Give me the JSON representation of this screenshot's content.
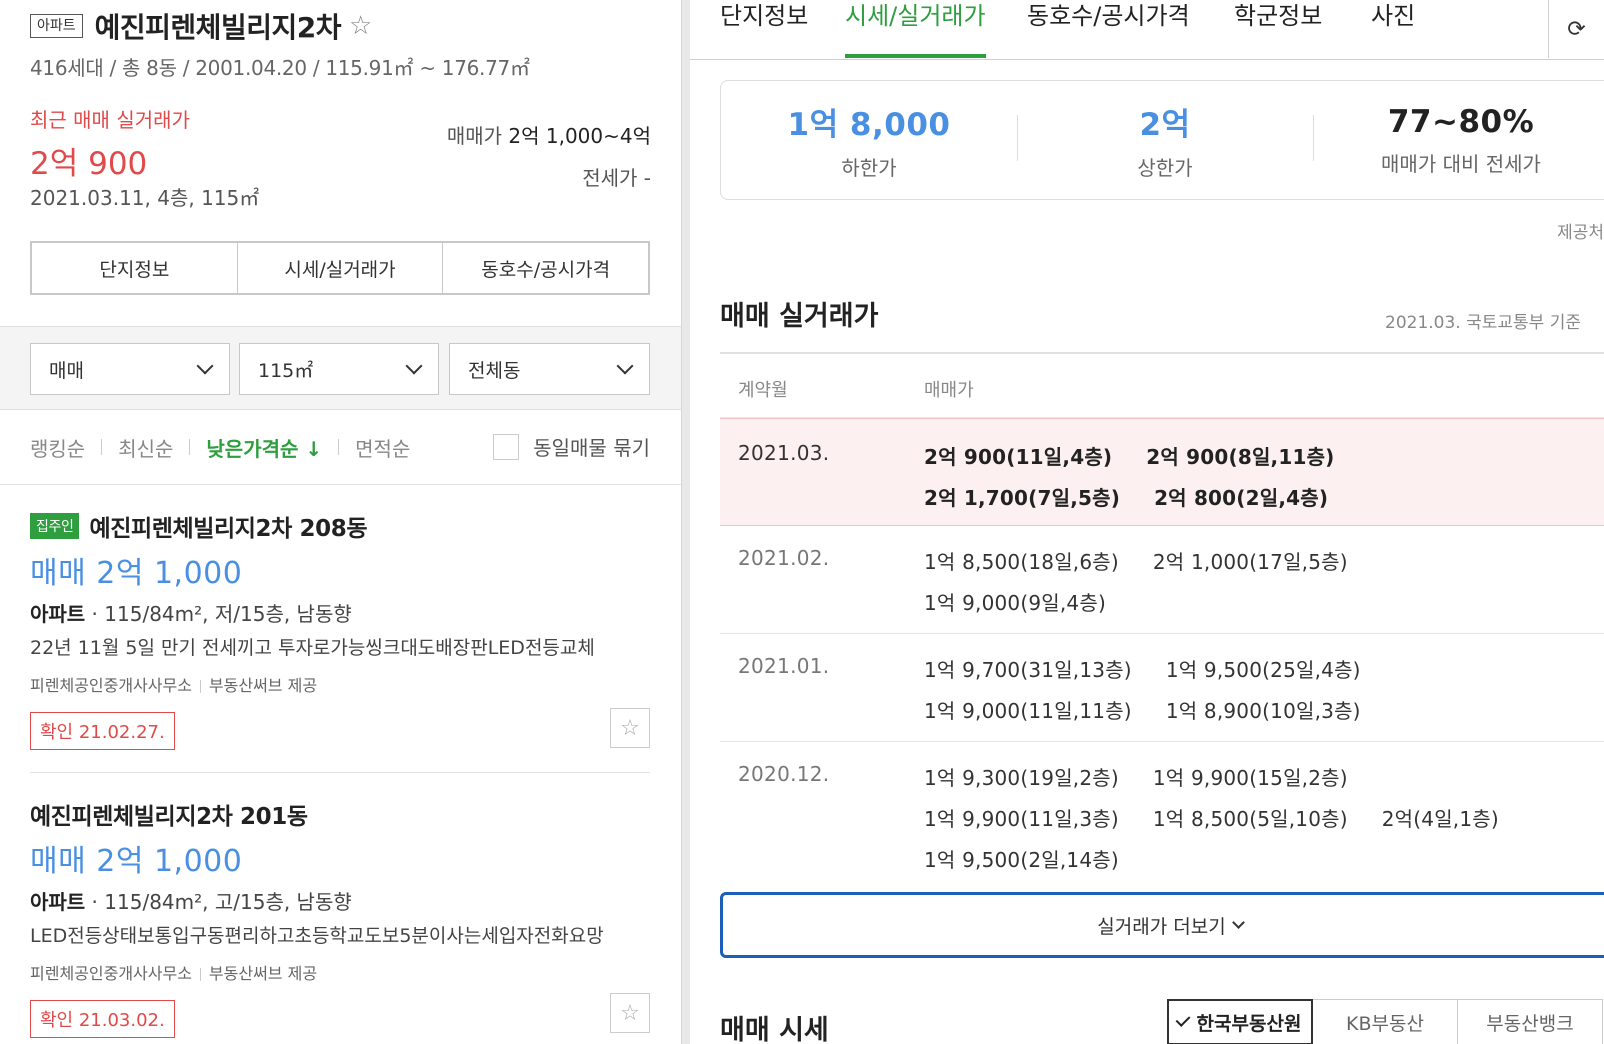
{
  "left": {
    "type_badge": "아파트",
    "apt_name": "예진피렌체빌리지2차",
    "sub_info": "416세대 / 총 8동 / 2001.04.20 / 115.91㎡ ~ 176.77㎡",
    "recent_label": "최근 매매 실거래가",
    "recent_price": "2억 900",
    "recent_detail": "2021.03.11, 4층, 115㎡",
    "sale_range_label": "매매가",
    "sale_range_value": "2억 1,000~4억",
    "jeonse": "전세가 -",
    "tabs": [
      "단지정보",
      "시세/실거래가",
      "동호수/공시가격"
    ],
    "filters": {
      "trade": "매매",
      "area": "115㎡",
      "dong": "전체동"
    },
    "sort": {
      "s1": "랭킹순",
      "s2": "최신순",
      "s3": "낮은가격순 ↓",
      "s4": "면적순",
      "group": "동일매물 묶기"
    },
    "listings": [
      {
        "badge": "집주인",
        "title": "예진피렌체빌리지2차 208동",
        "price": "매매 2억 1,000",
        "type_bold": "아파트",
        "type_rest": " · 115/84m², 저/15층, 남동향",
        "desc": "22년 11월 5일 만기 전세끼고 투자로가능씽크대도배장판LED전등교체",
        "agent": "피렌체공인중개사사무소",
        "provider": "부동산써브 제공",
        "confirm": "확인 21.02.27."
      },
      {
        "badge": "",
        "title": "예진피렌체빌리지2차 201동",
        "price": "매매 2억 1,000",
        "type_bold": "아파트",
        "type_rest": " · 115/84m², 고/15층, 남동향",
        "desc": "LED전등상태보통입구동편리하고초등학교도보5분이사는세입자전화요망",
        "agent": "피렌체공인중개사사무소",
        "provider": "부동산써브 제공",
        "confirm": "확인 21.03.02."
      }
    ]
  },
  "right": {
    "tabs": [
      "단지정보",
      "시세/실거래가",
      "동호수/공시가격",
      "학군정보",
      "사진"
    ],
    "summary": [
      {
        "value": "1억 8,000",
        "label": "하한가"
      },
      {
        "value": "2억",
        "label": "상한가"
      },
      {
        "value": "77~80%",
        "label": "매매가 대비 전세가"
      }
    ],
    "source": "제공처",
    "section_title": "매매 실거래가",
    "basis": "2021.03. 국토교통부 기준",
    "col_month": "계약월",
    "col_price": "매매가",
    "rows": [
      {
        "month": "2021.03.",
        "lines": [
          [
            "2억 900(11일,4층)",
            "2억 900(8일,11층)"
          ],
          [
            "2억 1,700(7일,5층)",
            "2억 800(2일,4층)"
          ]
        ]
      },
      {
        "month": "2021.02.",
        "lines": [
          [
            "1억 8,500(18일,6층)",
            "2억 1,000(17일,5층)"
          ],
          [
            "1억 9,000(9일,4층)"
          ]
        ]
      },
      {
        "month": "2021.01.",
        "lines": [
          [
            "1억 9,700(31일,13층)",
            "1억 9,500(25일,4층)"
          ],
          [
            "1억 9,000(11일,11층)",
            "1억 8,900(10일,3층)"
          ]
        ]
      },
      {
        "month": "2020.12.",
        "lines": [
          [
            "1억 9,300(19일,2층)",
            "1억 9,900(15일,2층)"
          ],
          [
            "1억 9,900(11일,3층)",
            "1억 8,500(5일,10층)",
            "2억(4일,1층)"
          ],
          [
            "1억 9,500(2일,14층)"
          ]
        ]
      }
    ],
    "more_button": "실거래가 더보기",
    "section2_title": "매매 시세",
    "providers": [
      "한국부동산원",
      "KB부동산",
      "부동산뱅크"
    ]
  }
}
